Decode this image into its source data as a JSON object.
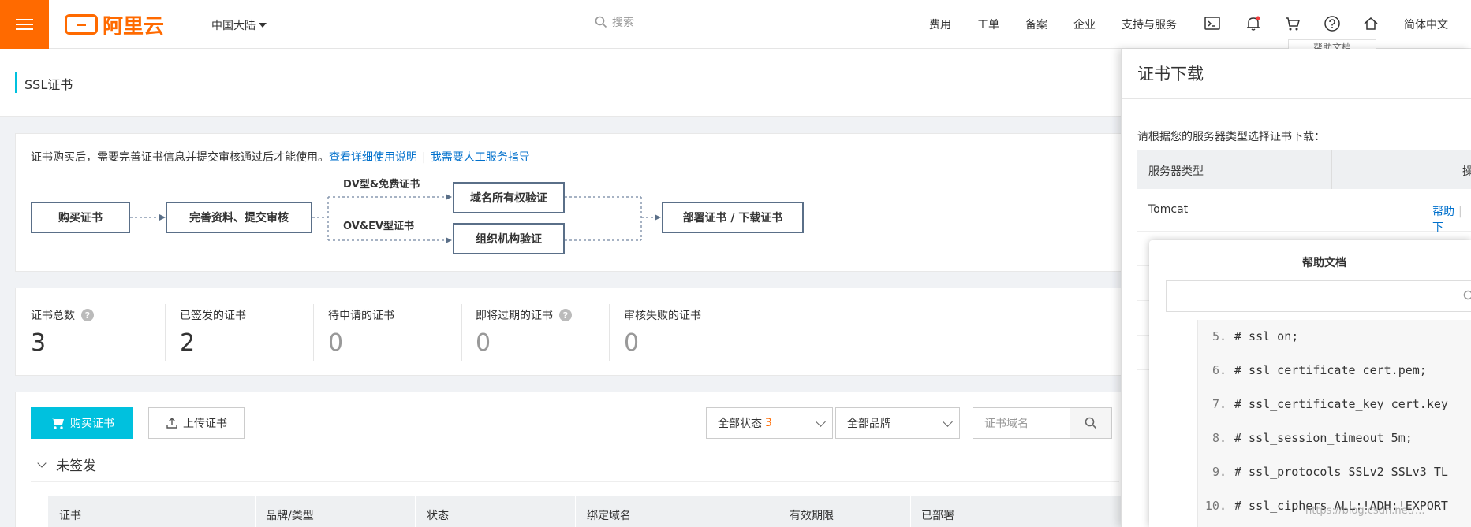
{
  "header": {
    "logo": "阿里云",
    "region": "中国大陆",
    "search_placeholder": "搜索",
    "nav": [
      "费用",
      "工单",
      "备案",
      "企业",
      "支持与服务"
    ],
    "language": "简体中文",
    "help_tip": "帮助文档"
  },
  "page": {
    "title": "SSL证书"
  },
  "info": {
    "text": "证书购买后，需要完善证书信息并提交审核通过后才能使用。",
    "link1": "查看详细使用说明",
    "link2": "我需要人工服务指导",
    "flow": {
      "step1": "购买证书",
      "step2": "完善资料、提交审核",
      "branch1_label": "DV型&免费证书",
      "branch1": "域名所有权验证",
      "branch2_label": "OV&EV型证书",
      "branch2": "组织机构验证",
      "step4": "部署证书 / 下载证书"
    }
  },
  "stats": [
    {
      "label": "证书总数",
      "value": "3",
      "help": true
    },
    {
      "label": "已签发的证书",
      "value": "2",
      "help": false
    },
    {
      "label": "待申请的证书",
      "value": "0",
      "help": false
    },
    {
      "label": "即将过期的证书",
      "value": "0",
      "help": true
    },
    {
      "label": "审核失败的证书",
      "value": "0",
      "help": false
    }
  ],
  "toolbar": {
    "buy": "购买证书",
    "upload": "上传证书",
    "status_filter": "全部状态",
    "status_count": "3",
    "brand_filter": "全部品牌",
    "domain_placeholder": "证书域名"
  },
  "group": {
    "title": "未签发"
  },
  "table": {
    "columns": [
      "证书",
      "品牌/类型",
      "状态",
      "绑定域名",
      "有效期限",
      "已部署"
    ]
  },
  "drawer": {
    "title": "证书下载",
    "hint": "请根据您的服务器类型选择证书下载：",
    "col_server": "服务器类型",
    "col_action": "操",
    "row_name": "Tomcat",
    "row_help": "帮助",
    "row_download": "下"
  },
  "help_panel": {
    "title": "帮助文档",
    "code": [
      {
        "n": "5.",
        "text": "# ssl on;"
      },
      {
        "n": "6.",
        "text": "# ssl_certificate cert.pem;"
      },
      {
        "n": "7.",
        "text": "# ssl_certificate_key cert.key"
      },
      {
        "n": "8.",
        "text": "# ssl_session_timeout 5m;"
      },
      {
        "n": "9.",
        "text": "# ssl_protocols SSLv2 SSLv3 TL"
      },
      {
        "n": "10.",
        "text": "# ssl_ciphers ALL:!ADH:!EXPORT"
      }
    ]
  },
  "watermark": "https://blog.csdn.net/..."
}
